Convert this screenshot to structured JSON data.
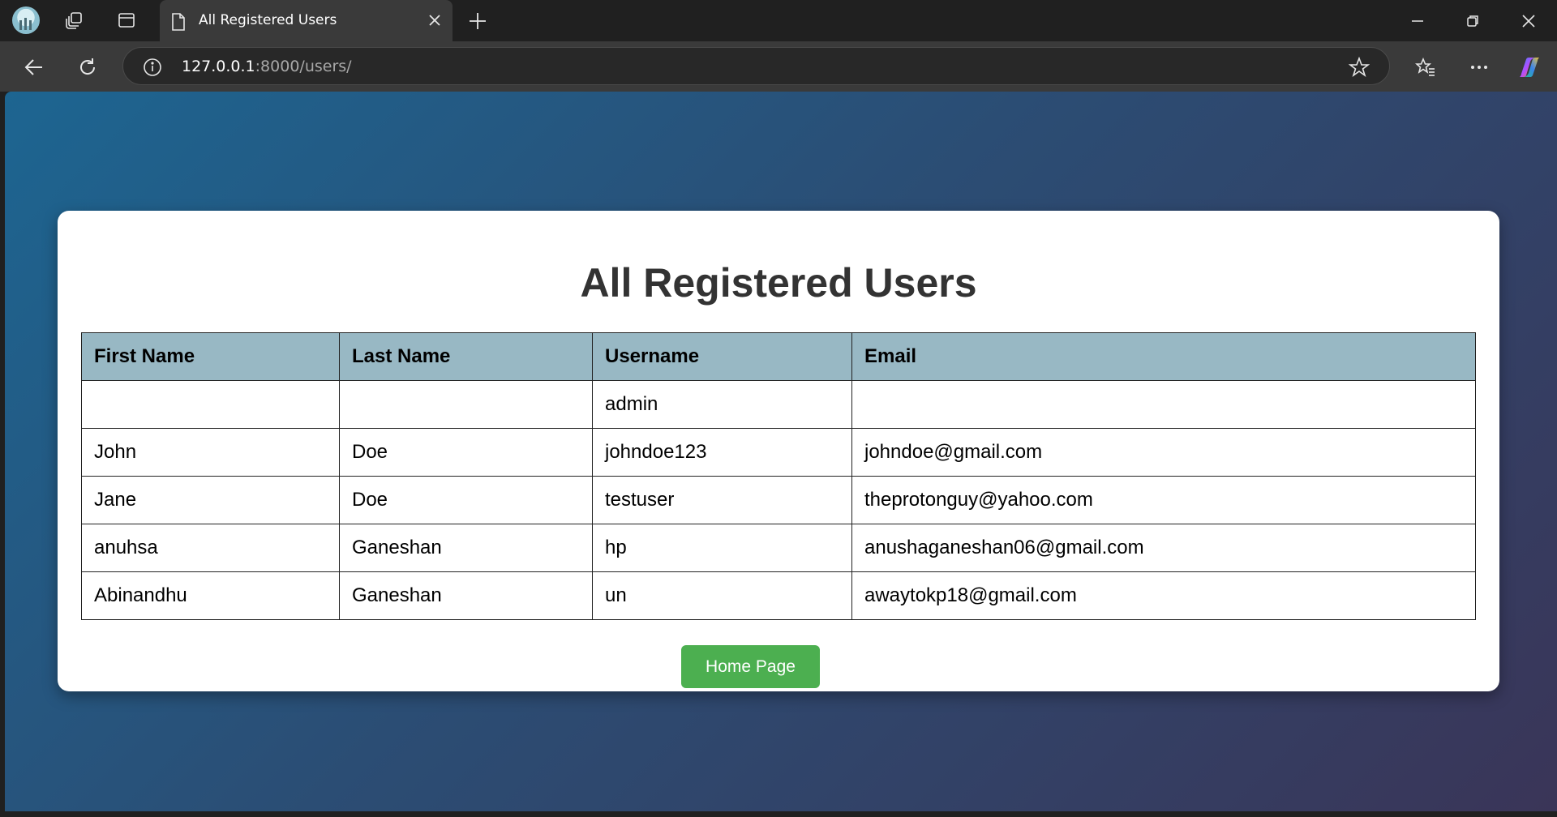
{
  "browser": {
    "tab": {
      "title": "All Registered Users"
    },
    "address": {
      "host": "127.0.0.1",
      "path": ":8000/users/"
    }
  },
  "page": {
    "title": "All Registered Users",
    "table": {
      "headers": [
        "First Name",
        "Last Name",
        "Username",
        "Email"
      ],
      "rows": [
        [
          "",
          "",
          "admin",
          ""
        ],
        [
          "John",
          "Doe",
          "johndoe123",
          "johndoe@gmail.com"
        ],
        [
          "Jane",
          "Doe",
          "testuser",
          "theprotonguy@yahoo.com"
        ],
        [
          "anuhsa",
          "Ganeshan",
          "hp",
          "anushaganeshan06@gmail.com"
        ],
        [
          "Abinandhu",
          "Ganeshan",
          "un",
          "awaytokp18@gmail.com"
        ]
      ]
    },
    "home_button_label": "Home Page"
  },
  "colors": {
    "header_bg": "#98b8c4",
    "button_bg": "#4caf50",
    "gradient_start": "#1d6591",
    "gradient_end": "#3a3558"
  }
}
